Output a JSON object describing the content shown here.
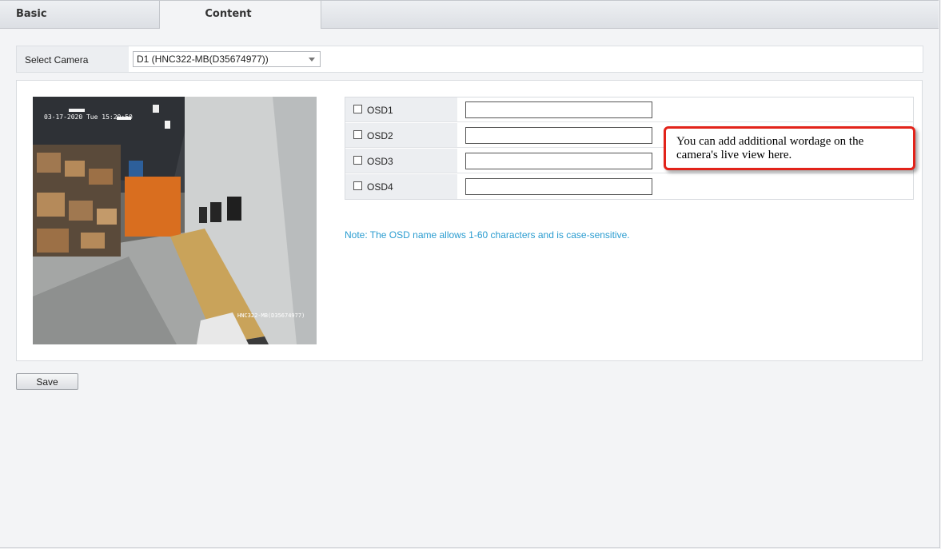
{
  "tabs": [
    {
      "label": "Basic",
      "active": false
    },
    {
      "label": "Content",
      "active": true
    }
  ],
  "camera": {
    "label": "Select Camera",
    "selected": "D1 (HNC322-MB(D35674977))"
  },
  "preview": {
    "timestamp_overlay": "03-17-2020 Tue 15:20:50",
    "name_overlay": "HNC322-MB(D35674977)"
  },
  "osd": {
    "rows": [
      {
        "label": "OSD1",
        "checked": false,
        "value": ""
      },
      {
        "label": "OSD2",
        "checked": false,
        "value": ""
      },
      {
        "label": "OSD3",
        "checked": false,
        "value": ""
      },
      {
        "label": "OSD4",
        "checked": false,
        "value": ""
      }
    ],
    "note": "Note: The OSD name allows 1-60 characters and is case-sensitive."
  },
  "callout": {
    "text": "You can add additional wordage on the camera's live view here.",
    "border_color": "#e2231a"
  },
  "save_label": "Save",
  "colors": {
    "note": "#2a9cd0",
    "background": "#f3f4f6"
  }
}
